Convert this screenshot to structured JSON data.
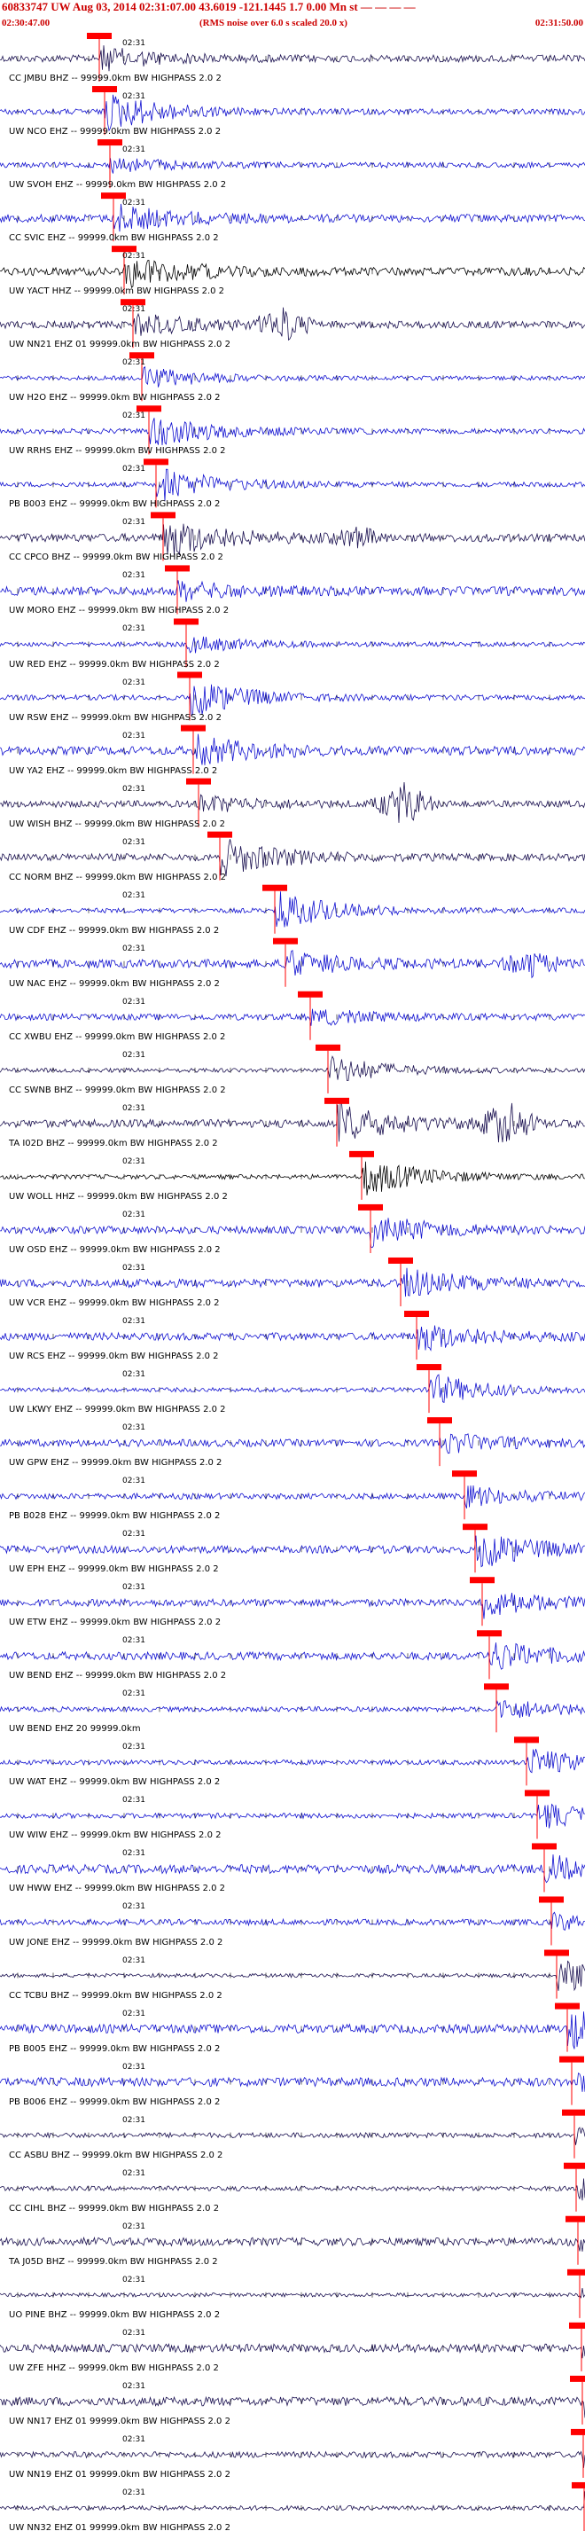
{
  "header": {
    "title": "60833747 UW Aug 03, 2014 02:31:07.00   43.6019 -121.1445  1.7 0.00 Mn st — — — —",
    "time_left": "02:30:47.00",
    "note": "(RMS noise over 6.0 s scaled 20.0 x)",
    "time_right": "02:31:50.00"
  },
  "colors": {
    "blue": "#1010d0",
    "navy": "#1a1050",
    "black": "#000000",
    "pick": "#ff0000",
    "header": "#cc0000"
  },
  "time_mark_label": "02:31",
  "channels": [
    {
      "label": "CC JMBU BHZ -- 99999.0km BW HIGHPASS  2.0  2",
      "color": "navy"
    },
    {
      "label": "UW NCO EHZ -- 99999.0km BW HIGHPASS  2.0  2",
      "color": "blue"
    },
    {
      "label": "UW SVOH EHZ -- 99999.0km BW HIGHPASS  2.0  2",
      "color": "blue"
    },
    {
      "label": "CC SVIC EHZ -- 99999.0km BW HIGHPASS  2.0  2",
      "color": "blue"
    },
    {
      "label": "UW YACT HHZ -- 99999.0km BW HIGHPASS  2.0  2",
      "color": "black"
    },
    {
      "label": "UW NN21 EHZ 01 99999.0km BW HIGHPASS  2.0  2",
      "color": "navy"
    },
    {
      "label": "UW H2O EHZ -- 99999.0km BW HIGHPASS  2.0  2",
      "color": "blue"
    },
    {
      "label": "UW RRHS EHZ -- 99999.0km BW HIGHPASS  2.0  2",
      "color": "blue"
    },
    {
      "label": "PB B003 EHZ -- 99999.0km BW HIGHPASS  2.0  2",
      "color": "blue"
    },
    {
      "label": "CC CPCO BHZ -- 99999.0km BW HIGHPASS  2.0  2",
      "color": "navy"
    },
    {
      "label": "UW MORO EHZ -- 99999.0km BW HIGHPASS  2.0  2",
      "color": "blue"
    },
    {
      "label": "UW RED EHZ -- 99999.0km BW HIGHPASS  2.0  2",
      "color": "blue"
    },
    {
      "label": "UW RSW EHZ -- 99999.0km BW HIGHPASS  2.0  2",
      "color": "blue"
    },
    {
      "label": "UW YA2 EHZ -- 99999.0km BW HIGHPASS  2.0  2",
      "color": "blue"
    },
    {
      "label": "UW WISH BHZ -- 99999.0km BW HIGHPASS  2.0  2",
      "color": "navy"
    },
    {
      "label": "CC NORM BHZ -- 99999.0km BW HIGHPASS  2.0  2",
      "color": "navy"
    },
    {
      "label": "UW CDF EHZ -- 99999.0km BW HIGHPASS  2.0  2",
      "color": "blue"
    },
    {
      "label": "UW NAC EHZ -- 99999.0km BW HIGHPASS  2.0  2",
      "color": "blue"
    },
    {
      "label": "CC XWBU EHZ -- 99999.0km BW HIGHPASS  2.0  2",
      "color": "blue"
    },
    {
      "label": "CC SWNB BHZ -- 99999.0km BW HIGHPASS  2.0  2",
      "color": "navy"
    },
    {
      "label": "TA I02D BHZ -- 99999.0km BW HIGHPASS  2.0  2",
      "color": "navy"
    },
    {
      "label": "UW WOLL HHZ -- 99999.0km BW HIGHPASS  2.0  2",
      "color": "black"
    },
    {
      "label": "UW OSD EHZ -- 99999.0km BW HIGHPASS  2.0  2",
      "color": "blue"
    },
    {
      "label": "UW VCR EHZ -- 99999.0km BW HIGHPASS  2.0  2",
      "color": "blue"
    },
    {
      "label": "UW RCS EHZ -- 99999.0km BW HIGHPASS  2.0  2",
      "color": "blue"
    },
    {
      "label": "UW LKWY EHZ -- 99999.0km BW HIGHPASS  2.0  2",
      "color": "blue"
    },
    {
      "label": "UW GPW EHZ -- 99999.0km BW HIGHPASS  2.0  2",
      "color": "blue"
    },
    {
      "label": "PB B028 EHZ -- 99999.0km BW HIGHPASS  2.0  2",
      "color": "blue"
    },
    {
      "label": "UW EPH EHZ -- 99999.0km BW HIGHPASS  2.0  2",
      "color": "blue"
    },
    {
      "label": "UW ETW EHZ -- 99999.0km BW HIGHPASS  2.0  2",
      "color": "blue"
    },
    {
      "label": "UW BEND EHZ -- 99999.0km BW HIGHPASS  2.0  2",
      "color": "blue"
    },
    {
      "label": "UW BEND EHZ 20 99999.0km",
      "color": "blue"
    },
    {
      "label": "UW WAT EHZ -- 99999.0km BW HIGHPASS  2.0  2",
      "color": "blue"
    },
    {
      "label": "UW WIW EHZ -- 99999.0km BW HIGHPASS  2.0  2",
      "color": "blue"
    },
    {
      "label": "UW HWW EHZ -- 99999.0km BW HIGHPASS  2.0  2",
      "color": "blue"
    },
    {
      "label": "UW JONE EHZ -- 99999.0km BW HIGHPASS  2.0  2",
      "color": "blue"
    },
    {
      "label": "CC TCBU BHZ -- 99999.0km BW HIGHPASS  2.0  2",
      "color": "navy"
    },
    {
      "label": "PB B005 EHZ -- 99999.0km BW HIGHPASS  2.0  2",
      "color": "blue"
    },
    {
      "label": "PB B006 EHZ -- 99999.0km BW HIGHPASS  2.0  2",
      "color": "blue"
    },
    {
      "label": "CC ASBU BHZ -- 99999.0km BW HIGHPASS  2.0  2",
      "color": "navy"
    },
    {
      "label": "CC CIHL BHZ -- 99999.0km BW HIGHPASS  2.0  2",
      "color": "navy"
    },
    {
      "label": "TA J05D BHZ -- 99999.0km BW HIGHPASS  2.0  2",
      "color": "navy"
    },
    {
      "label": "UO PINE BHZ -- 99999.0km BW HIGHPASS  2.0  2",
      "color": "navy"
    },
    {
      "label": "UW ZFE HHZ -- 99999.0km BW HIGHPASS  2.0  2",
      "color": "navy"
    },
    {
      "label": "UW NN17 EHZ 01 99999.0km BW HIGHPASS  2.0  2",
      "color": "navy"
    },
    {
      "label": "UW NN19 EHZ 01 99999.0km BW HIGHPASS  2.0  2",
      "color": "navy"
    },
    {
      "label": "UW NN32 EHZ 01 99999.0km BW HIGHPASS  2.0  2",
      "color": "navy"
    }
  ]
}
